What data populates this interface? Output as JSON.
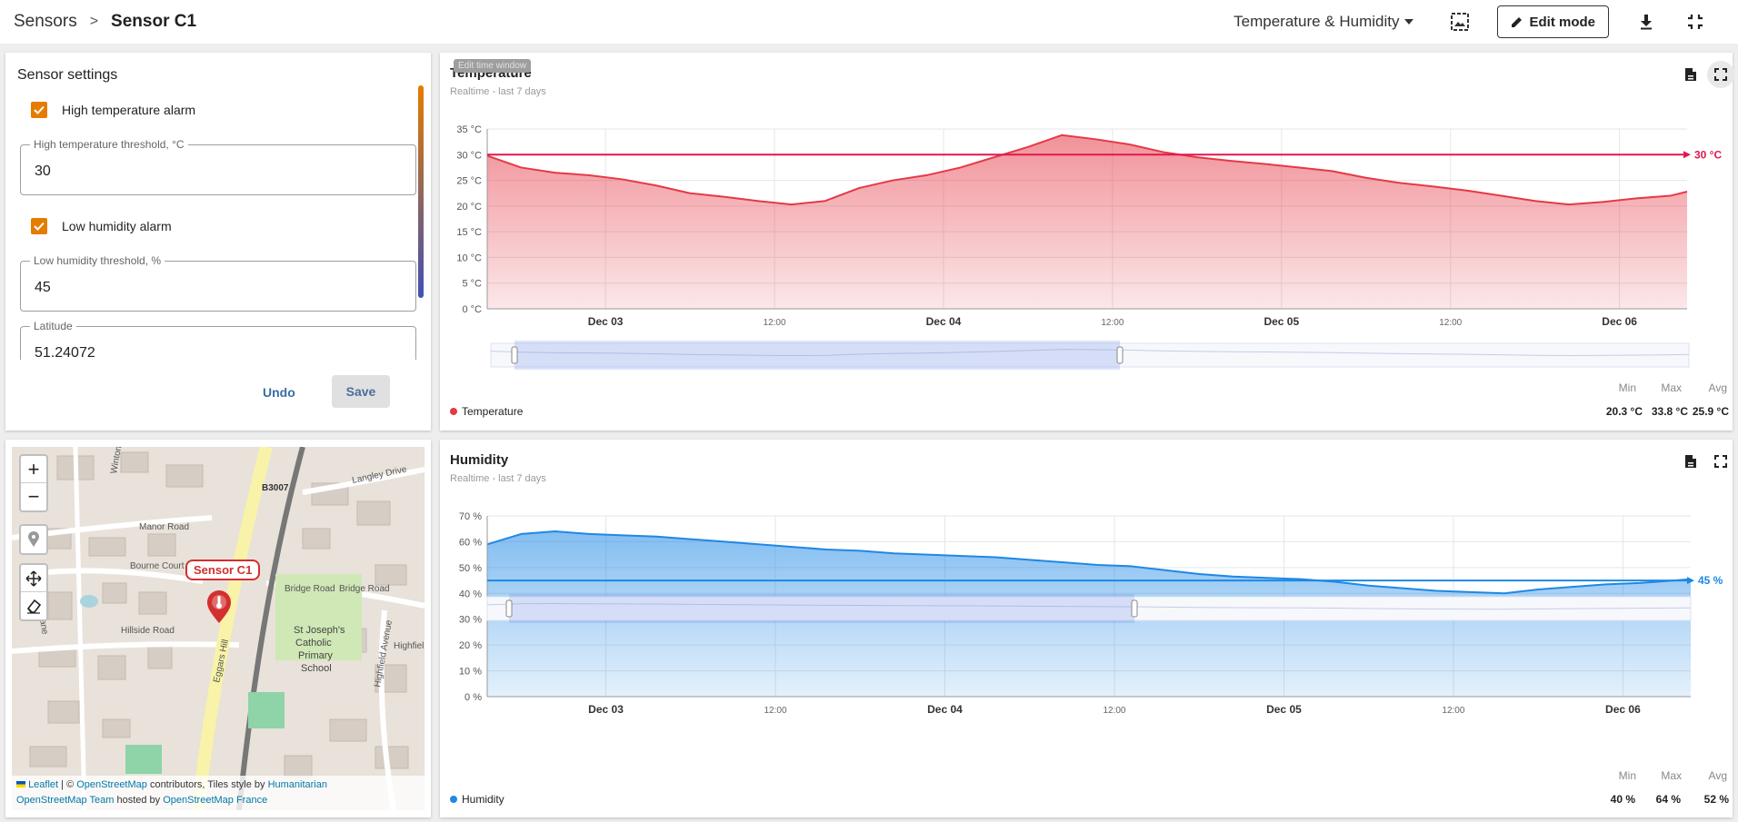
{
  "breadcrumb": {
    "root": "Sensors",
    "separator": ">",
    "current": "Sensor C1"
  },
  "toolbar": {
    "dashboard": "Temperature & Humidity",
    "edit_mode": "Edit mode"
  },
  "settings": {
    "title": "Sensor settings",
    "high_temp_alarm": "High temperature alarm",
    "high_temp_threshold_label": "High temperature threshold, °C",
    "high_temp_threshold_value": "30",
    "low_hum_alarm": "Low humidity alarm",
    "low_hum_threshold_label": "Low humidity threshold, %",
    "low_hum_threshold_value": "45",
    "latitude_label": "Latitude",
    "latitude_value": "51.24072",
    "undo": "Undo",
    "save": "Save"
  },
  "map": {
    "zoom_in": "+",
    "zoom_out": "−",
    "marker_label": "Sensor C1",
    "roads": [
      "B3007",
      "Manor Road",
      "Bourne Court",
      "Bridge Road",
      "Bridge Road",
      "Hillside Road",
      "Eggars Hill",
      "Highfield Avenue",
      "Highfiel",
      "Langley Drive",
      "Winton Road",
      "Lane"
    ],
    "poi": [
      "St Joseph's",
      "Catholic",
      "Primary",
      "School"
    ],
    "attribution_1a": "Leaflet",
    "attribution_1b": " | © ",
    "attribution_1c": "OpenStreetMap",
    "attribution_1d": " contributors, Tiles style by ",
    "attribution_1e": "Humanitarian",
    "attribution_2a": "OpenStreetMap Team",
    "attribution_2b": " hosted by ",
    "attribution_2c": "OpenStreetMap France"
  },
  "temperature": {
    "title": "Temperature",
    "subtitle": "Realtime - last 7 days",
    "tooltip": "Edit time window",
    "threshold_label": "30 °C",
    "legend": "Temperature",
    "stats_headers": [
      "Min",
      "Max",
      "Avg"
    ],
    "stats_values": [
      "20.3 °C",
      "33.8 °C",
      "25.9 °C"
    ]
  },
  "humidity": {
    "title": "Humidity",
    "subtitle": "Realtime - last 7 days",
    "threshold_label": "45 %",
    "legend": "Humidity",
    "stats_headers": [
      "Min",
      "Max",
      "Avg"
    ],
    "stats_values": [
      "40 %",
      "64 %",
      "52 %"
    ]
  },
  "colors": {
    "accent": "#e57c00",
    "temp": "#e53946",
    "hum": "#1e88e5",
    "threshold_temp": "#e0174f"
  },
  "chart_data": [
    {
      "type": "area",
      "y_ticks": [
        "0 °C",
        "5 °C",
        "10 °C",
        "15 °C",
        "20 °C",
        "25 °C",
        "30 °C",
        "35 °C"
      ],
      "x_ticks": [
        "Dec 03",
        "12:00",
        "Dec 04",
        "12:00",
        "Dec 05",
        "12:00",
        "Dec 06"
      ],
      "ylim": [
        0,
        35
      ],
      "threshold": 30,
      "series": [
        {
          "name": "Temperature",
          "x": [
            0,
            0.1,
            0.2,
            0.3,
            0.4,
            0.5,
            0.6,
            0.7,
            0.8,
            0.9,
            1.0,
            1.1,
            1.2,
            1.3,
            1.4,
            1.5,
            1.6,
            1.7,
            1.8,
            1.9,
            2.0,
            2.1,
            2.2,
            2.3,
            2.4,
            2.5,
            2.6,
            2.7,
            2.8,
            2.9,
            3.0,
            3.1,
            3.2,
            3.3,
            3.4,
            3.5,
            3.55
          ],
          "values": [
            29.8,
            27.5,
            26.5,
            26.0,
            25.2,
            24.0,
            22.5,
            21.8,
            21.0,
            20.3,
            21.0,
            23.5,
            25.0,
            26.0,
            27.5,
            29.5,
            31.5,
            33.8,
            33.0,
            32.0,
            30.5,
            29.5,
            28.8,
            28.2,
            27.5,
            26.8,
            25.5,
            24.5,
            23.8,
            23.0,
            22.0,
            21.0,
            20.3,
            20.8,
            21.5,
            22.0,
            22.8
          ]
        }
      ]
    },
    {
      "type": "area",
      "y_ticks": [
        "0 %",
        "10 %",
        "20 %",
        "30 %",
        "40 %",
        "50 %",
        "60 %",
        "70 %"
      ],
      "x_ticks": [
        "Dec 03",
        "12:00",
        "Dec 04",
        "12:00",
        "Dec 05",
        "12:00",
        "Dec 06"
      ],
      "ylim": [
        0,
        70
      ],
      "threshold": 45,
      "series": [
        {
          "name": "Humidity",
          "x": [
            0,
            0.1,
            0.2,
            0.3,
            0.4,
            0.5,
            0.6,
            0.7,
            0.8,
            0.9,
            1.0,
            1.1,
            1.2,
            1.3,
            1.4,
            1.5,
            1.6,
            1.7,
            1.8,
            1.9,
            2.0,
            2.1,
            2.2,
            2.3,
            2.4,
            2.5,
            2.6,
            2.7,
            2.8,
            2.9,
            3.0,
            3.1,
            3.2,
            3.3,
            3.4,
            3.5,
            3.55
          ],
          "values": [
            59,
            63,
            64,
            63,
            62.5,
            62,
            61,
            60,
            59,
            58,
            57,
            56.5,
            55.5,
            55,
            54.5,
            54,
            53,
            52,
            51,
            50.5,
            49,
            47.5,
            46.5,
            46,
            45.5,
            44.5,
            43,
            42,
            41,
            40.5,
            40,
            41.5,
            42.5,
            43.5,
            44,
            45,
            45.5
          ]
        }
      ]
    }
  ]
}
